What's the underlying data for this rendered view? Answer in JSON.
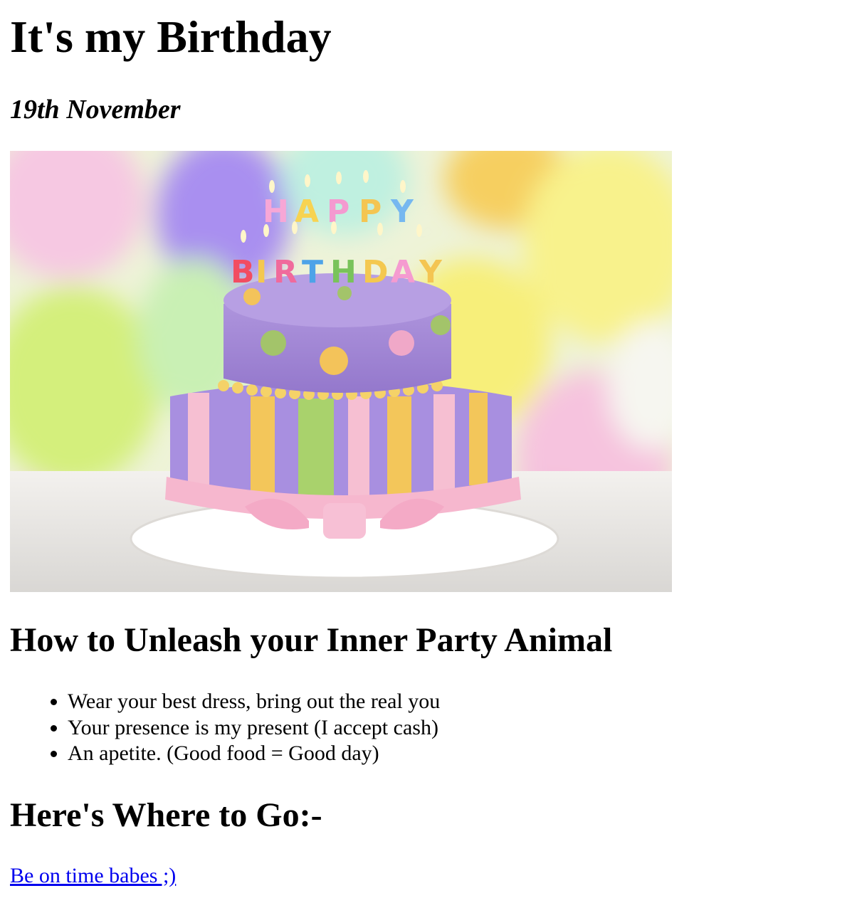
{
  "page": {
    "title": "It's my Birthday",
    "date": "19th November"
  },
  "hero_image": {
    "cake_candles_top": "HAPPY",
    "cake_candles_bottom": "BIRTHDAY",
    "colors": {
      "purple": "#a58bd6",
      "yellow": "#f4c95a",
      "green": "#a8cf6a",
      "pink": "#f6b8cf"
    }
  },
  "section1": {
    "heading": "How to Unleash your Inner Party Animal",
    "items": [
      "Wear your best dress, bring out the real you",
      "Your presence is my present (I accept cash)",
      "An apetite. (Good food = Good day)"
    ]
  },
  "section2": {
    "heading": "Here's Where to Go:-",
    "link_text": "Be on time babes ;)"
  }
}
